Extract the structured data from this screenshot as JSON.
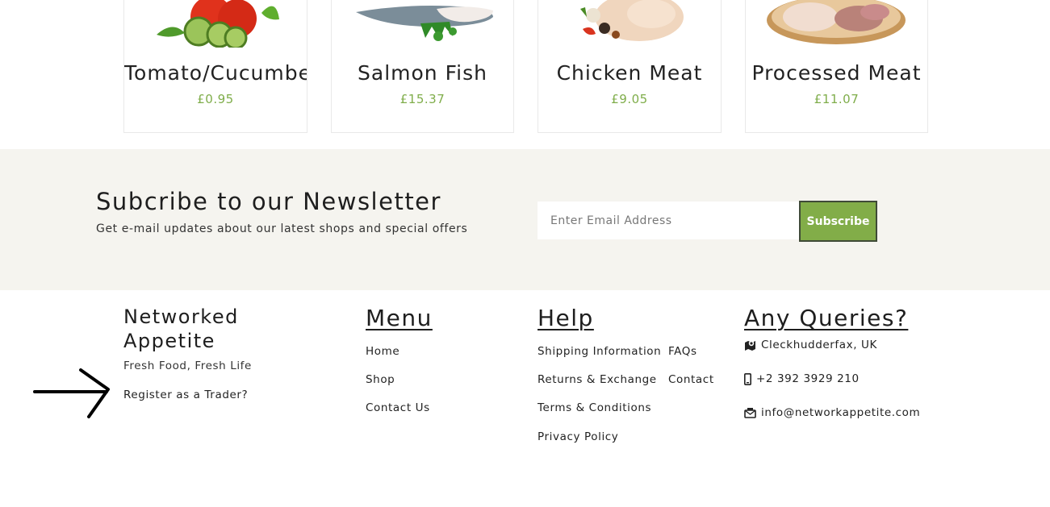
{
  "products": [
    {
      "name": "Tomato/Cucumber",
      "price": "£0.95",
      "image": "tomato-cucumber-image"
    },
    {
      "name": "Salmon Fish",
      "price": "£15.37",
      "image": "salmon-fish-image"
    },
    {
      "name": "Chicken Meat",
      "price": "£9.05",
      "image": "chicken-meat-image"
    },
    {
      "name": "Processed Meat",
      "price": "£11.07",
      "image": "processed-meat-image"
    }
  ],
  "newsletter": {
    "title": "Subcribe to our Newsletter",
    "subtitle": "Get e-mail updates about our latest shops and special offers",
    "email_placeholder": "Enter Email Address",
    "button_label": "Subscribe"
  },
  "footer": {
    "brand_line1": "Networked",
    "brand_line2": "Appetite",
    "tagline": "Fresh Food, Fresh Life",
    "register_link": "Register as a Trader?",
    "menu": {
      "title": "Menu",
      "links": [
        "Home",
        "Shop",
        "Contact Us"
      ]
    },
    "help": {
      "title": "Help",
      "links_col1": [
        "Shipping Information",
        "Returns & Exchange",
        "Terms & Conditions",
        "Privacy Policy"
      ],
      "links_col2": [
        "FAQs",
        "Contact"
      ]
    },
    "queries": {
      "title": "Any Queries?",
      "location": "Cleckhudderfax, UK",
      "phone": "+2 392 3929 210",
      "email": "info@networkappetite.com"
    }
  },
  "colors": {
    "accent_green": "#82ad48",
    "price_green": "#7fad4a",
    "newsletter_bg": "#f5f4ef"
  },
  "icons": [
    "map-icon",
    "phone-icon",
    "envelope-icon",
    "arrow-annotation"
  ]
}
